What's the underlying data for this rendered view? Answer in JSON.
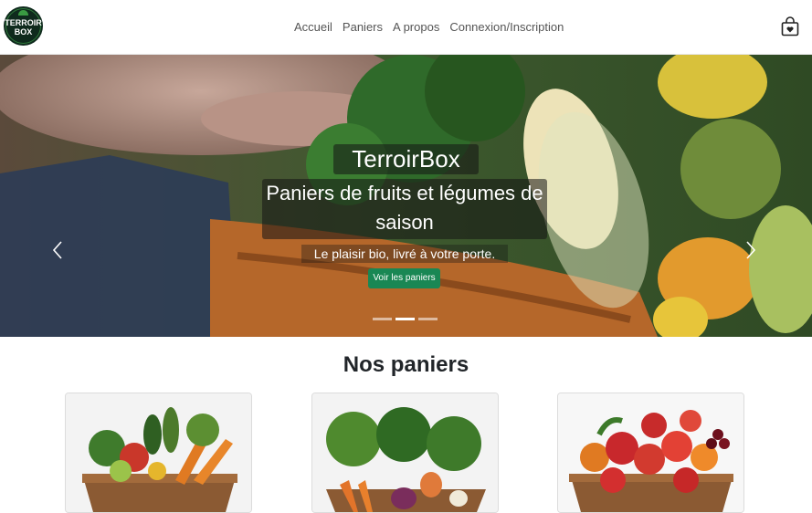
{
  "brand": {
    "line1": "TERROIR",
    "line2": "BOX"
  },
  "nav": {
    "items": [
      {
        "label": "Accueil"
      },
      {
        "label": "Paniers"
      },
      {
        "label": "A propos"
      },
      {
        "label": "Connexion/Inscription"
      }
    ]
  },
  "hero": {
    "title": "TerroirBox",
    "subtitle": "Paniers de fruits et légumes de saison",
    "tagline": "Le plaisir bio, livré à votre porte.",
    "cta": "Voir les paniers",
    "slides": 3,
    "active_slide": 2
  },
  "section": {
    "title": "Nos paniers"
  },
  "cards": [
    {
      "icon": "mixed-vegetable-basket"
    },
    {
      "icon": "leafy-vegetable-basket"
    },
    {
      "icon": "fruit-basket"
    }
  ],
  "colors": {
    "accent": "#198754",
    "logo_bg": "#0f2a1d"
  }
}
